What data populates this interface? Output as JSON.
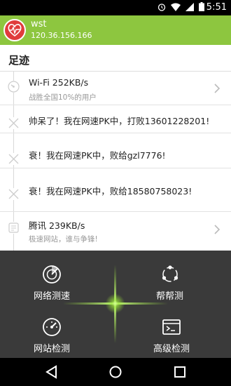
{
  "status_bar": {
    "time": "5:51",
    "icons": [
      "alarm-icon",
      "wifi-icon",
      "signal-icon",
      "battery-icon"
    ]
  },
  "header": {
    "username": "wst",
    "ip": "120.36.156.166",
    "accent_color": "#8dc63f",
    "logo_color": "#e03c3c"
  },
  "section": {
    "title": "足迹"
  },
  "timeline": [
    {
      "title": "Wi-Fi  252KB/s",
      "subtitle": "战胜全国10%的用户",
      "has_chevron": true,
      "icon": "speedometer-icon"
    },
    {
      "title": "帅呆了！我在网速PK中，打败13601228201!",
      "subtitle": "",
      "has_chevron": false,
      "icon": "cross-icon"
    },
    {
      "title": "衰！我在网速PK中，败给gzl7776!",
      "subtitle": "",
      "has_chevron": false,
      "icon": "cross-icon"
    },
    {
      "title": "衰！我在网速PK中，败给18580758023!",
      "subtitle": "",
      "has_chevron": false,
      "icon": "cross-icon"
    },
    {
      "title": "腾讯 239KB/s",
      "subtitle": "极速网站，谁与争锋!",
      "has_chevron": true,
      "icon": "website-icon"
    }
  ],
  "actions": {
    "network_speed": "网络测速",
    "help_test": "帮帮测",
    "site_test": "网站检测",
    "advanced_test": "高级检测"
  },
  "colors": {
    "panel_bg": "#3a3a3a",
    "glow": "#9be33a"
  }
}
